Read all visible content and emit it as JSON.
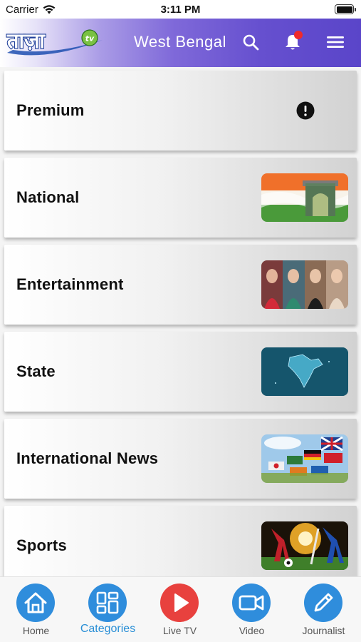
{
  "status_bar": {
    "carrier": "Carrier",
    "time": "3:11 PM"
  },
  "header": {
    "logo_text": "ताज़ा",
    "logo_badge": "tv",
    "region": "West Bengal",
    "icons": [
      "search-icon",
      "bell-icon",
      "menu-icon"
    ],
    "notification_dot": true
  },
  "categories": [
    {
      "label": "Premium",
      "thumbnail": "info-icon"
    },
    {
      "label": "National",
      "thumbnail": "india-gate-image"
    },
    {
      "label": "Entertainment",
      "thumbnail": "actresses-image"
    },
    {
      "label": "State",
      "thumbnail": "india-map-image"
    },
    {
      "label": "International News",
      "thumbnail": "flags-image"
    },
    {
      "label": "Sports",
      "thumbnail": "sports-image"
    }
  ],
  "tabs": [
    {
      "label": "Home",
      "icon": "home-icon",
      "active": false
    },
    {
      "label": "Categories",
      "icon": "grid-icon",
      "active": true
    },
    {
      "label": "Live TV",
      "icon": "play-icon",
      "active": false
    },
    {
      "label": "Video",
      "icon": "video-camera-icon",
      "active": false
    },
    {
      "label": "Journalist",
      "icon": "pencil-icon",
      "active": false
    }
  ],
  "colors": {
    "header_gradient_end": "#5a45c9",
    "accent_blue": "#2a8fd6",
    "tab_icon_blue": "#2f8ddc",
    "live_tv_red": "#e8413e",
    "notification_red": "#ef2a2a"
  }
}
